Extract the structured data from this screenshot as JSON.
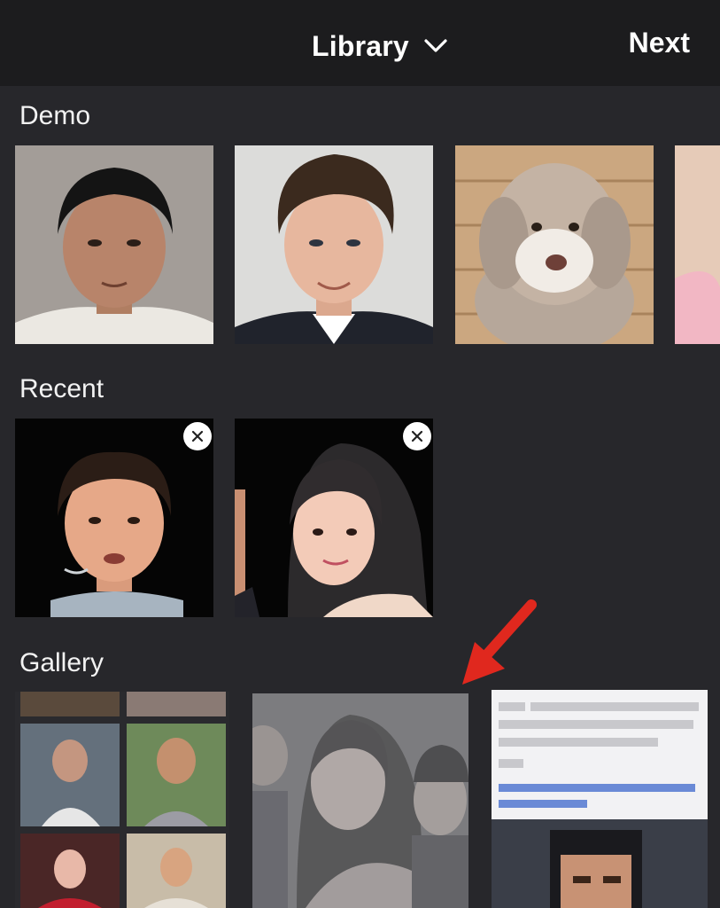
{
  "header": {
    "title": "Library",
    "next_label": "Next"
  },
  "sections": {
    "demo": "Demo",
    "recent": "Recent",
    "gallery": "Gallery"
  },
  "colors": {
    "background": "#27272b",
    "header_bg": "#1c1c1e",
    "text": "#ffffff",
    "arrow": "#e0281e"
  },
  "icons": {
    "title_chevron": "chevron-down-icon",
    "remove": "close-icon",
    "annotation": "red-arrow-icon"
  }
}
